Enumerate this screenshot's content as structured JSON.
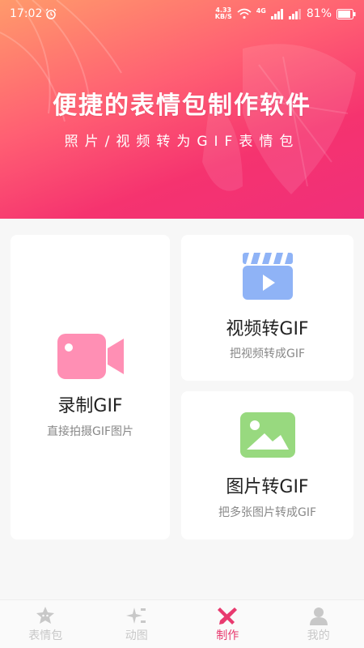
{
  "status_bar": {
    "time": "17:02",
    "network_speed_value": "4.33",
    "network_speed_unit": "KB/S",
    "network_type": "4G",
    "battery_percent": "81%"
  },
  "hero": {
    "title": "便捷的表情包制作软件",
    "subtitle": "照片/视频转为GIF表情包"
  },
  "cards": {
    "record": {
      "title": "录制GIF",
      "desc": "直接拍摄GIF图片",
      "icon": "video-camera-icon",
      "color": "#ff8fb4"
    },
    "video": {
      "title": "视频转GIF",
      "desc": "把视频转成GIF",
      "icon": "video-clapper-icon",
      "color": "#8fb3f6"
    },
    "image": {
      "title": "图片转GIF",
      "desc": "把多张图片转成GIF",
      "icon": "image-icon",
      "color": "#98d97f"
    }
  },
  "tabs": [
    {
      "label": "表情包",
      "icon": "sticker-face-icon",
      "active": false
    },
    {
      "label": "动图",
      "icon": "sparkle-icon",
      "active": false
    },
    {
      "label": "制作",
      "icon": "tools-cross-icon",
      "active": true
    },
    {
      "label": "我的",
      "icon": "user-icon",
      "active": false
    }
  ],
  "colors": {
    "accent": "#e83a6f",
    "inactive_tab": "#c8c8c8"
  }
}
